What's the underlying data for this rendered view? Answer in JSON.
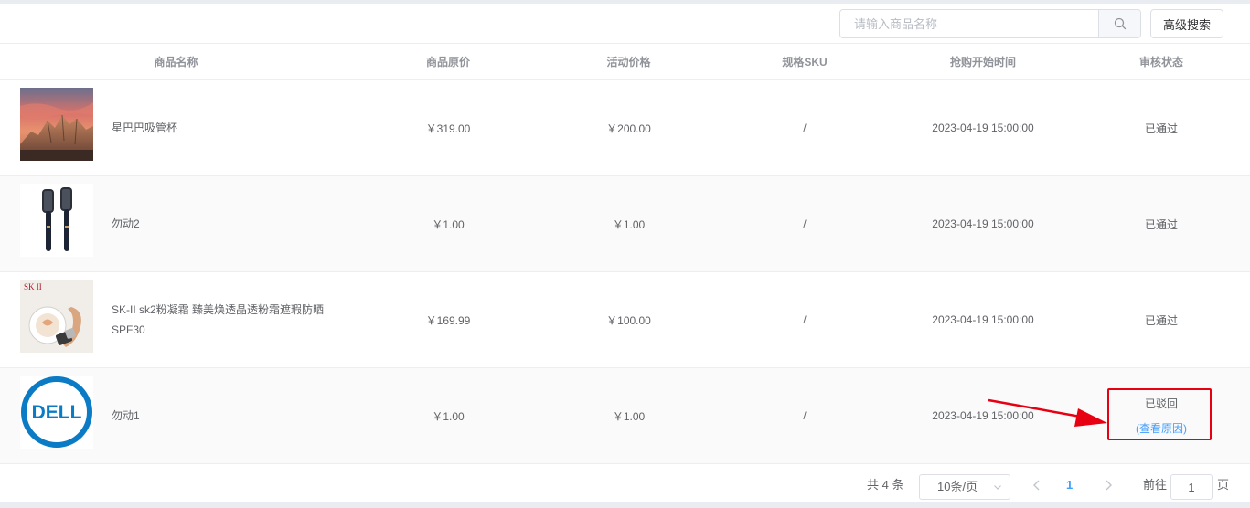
{
  "toolbar": {
    "search_placeholder": "请输入商品名称",
    "search_value": "",
    "advanced_search_label": "高级搜索"
  },
  "table": {
    "headers": [
      "商品名称",
      "商品原价",
      "活动价格",
      "规格SKU",
      "抢购开始时间",
      "审核状态"
    ],
    "rows": [
      {
        "name": "星巴巴吸管杯",
        "original_price": "￥319.00",
        "activity_price": "￥200.00",
        "sku": "/",
        "start_time": "2023-04-19 15:00:00",
        "status": "已通过",
        "image": "mountain-photo"
      },
      {
        "name": "勿动2",
        "original_price": "￥1.00",
        "activity_price": "￥1.00",
        "sku": "/",
        "start_time": "2023-04-19 15:00:00",
        "status": "已通过",
        "image": "hair-straightener-photo"
      },
      {
        "name": "SK-II sk2粉凝霜 臻美焕透晶透粉霜遮瑕防晒SPF30",
        "original_price": "￥169.99",
        "activity_price": "￥100.00",
        "sku": "/",
        "start_time": "2023-04-19 15:00:00",
        "status": "已通过",
        "image": "skii-cushion-photo",
        "image_text": "SK II"
      },
      {
        "name": "勿动1",
        "original_price": "￥1.00",
        "activity_price": "￥1.00",
        "sku": "/",
        "start_time": "2023-04-19 15:00:00",
        "status": "已驳回",
        "status_link": "(查看原因)",
        "image": "dell-logo",
        "image_text": "DELL"
      }
    ]
  },
  "pagination": {
    "total_label": "共 4 条",
    "page_size": "10条/页",
    "current_page": "1",
    "goto_prefix": "前往",
    "goto_value": "1",
    "goto_suffix": "页"
  },
  "colors": {
    "accent": "#409eff",
    "annotation": "#e60012"
  }
}
